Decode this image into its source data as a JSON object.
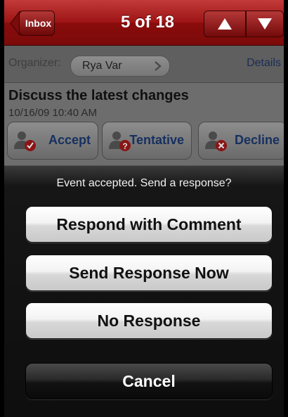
{
  "navbar": {
    "back_label": "Inbox",
    "title": "5 of 18",
    "prev_icon": "triangle-up-icon",
    "next_icon": "triangle-down-icon"
  },
  "organizer": {
    "label": "Organizer:",
    "name": "Rya Var",
    "details_link": "Details"
  },
  "event": {
    "subject": "Discuss the latest changes",
    "datetime": "10/16/09 10:40 AM"
  },
  "actions": [
    {
      "label": "Accept",
      "icon": "person-check-icon",
      "color": "#c82020"
    },
    {
      "label": "Tentative",
      "icon": "person-question-icon",
      "color": "#c82020"
    },
    {
      "label": "Decline",
      "icon": "person-x-icon",
      "color": "#c82020"
    }
  ],
  "sheet": {
    "message": "Event accepted. Send a response?",
    "buttons": [
      "Respond with Comment",
      "Send Response Now",
      "No Response"
    ],
    "cancel": "Cancel"
  },
  "colors": {
    "nav_red": "#9e1414",
    "link_blue": "#163060"
  }
}
